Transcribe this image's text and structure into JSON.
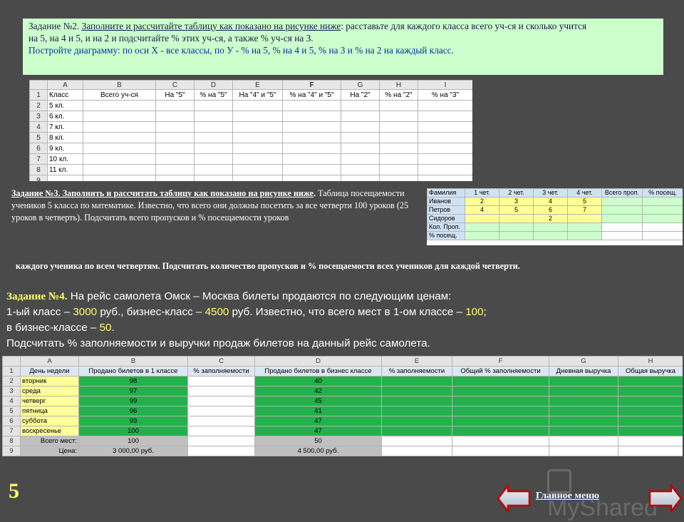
{
  "task2": {
    "line1_a": "Задание №2. ",
    "line1_u": "Заполните и рассчитайте таблицу как показано на рисунке ниже",
    "line1_b": ": расставьте  для каждого класса всего уч-ся и сколько учится",
    "line2": "на 5, на 4 и 5,  и на 2 и подсчитайте % этих уч-ся, а также % уч-ся на 3.",
    "line3": "Постройте диаграмму: по оси Х - все классы, по У - % на 5, % на 4 и 5, % на 3  и % на 2 на каждый класс."
  },
  "sheet1": {
    "cols": [
      "A",
      "B",
      "C",
      "D",
      "E",
      "F",
      "G",
      "H",
      "I"
    ],
    "rows": [
      "1",
      "2",
      "3",
      "4",
      "5",
      "6",
      "7",
      "8",
      "9"
    ],
    "headers": [
      "Класс",
      "Всего уч-ся",
      "На \"5\"",
      "% на \"5\"",
      "На \"4\" и \"5\"",
      "% на \"4\" и \"5\"",
      "На \"2\"",
      "% на \"2\"",
      "% на \"3\""
    ],
    "classes": [
      "5 кл.",
      "6 кл.",
      "7 кл.",
      "8 кл.",
      "9 кл.",
      "10 кл.",
      "11 кл."
    ]
  },
  "task3": {
    "title": "Задание №3. Заполнить и рассчитать таблицу как показано на рисунке ниже",
    "dot": ".",
    "body": "Таблица посещаемости учеников 5 класса по математике. Известно, что всего они должны посетить за все четверти 100 уроков (25 уроков в четверть). Подсчитать всего пропусков и % посещаемости уроков",
    "continuation": "каждого ученика по всем четвертям. Подсчитать количество пропусков и % посещаемости всех учеников для каждой четверти."
  },
  "sheet2": {
    "headers": [
      "Фамилия",
      "1 чет.",
      "2 чет.",
      "3 чет.",
      "4 чет.",
      "Всего проп.",
      "% посещ."
    ],
    "rows": [
      {
        "name": "Иванов",
        "q": [
          "2",
          "3",
          "4",
          "5"
        ]
      },
      {
        "name": "Петров",
        "q": [
          "4",
          "5",
          "6",
          "7"
        ]
      },
      {
        "name": "Сидоров",
        "q": [
          "",
          "",
          "2",
          ""
        ]
      }
    ],
    "footer": [
      "Кол. Проп.",
      "% посещ."
    ]
  },
  "task4": {
    "label": "Задание №4.",
    "line1": " На рейс самолета Омск – Москва билеты продаются по следующим ценам:",
    "l2a": "1-ый класс – ",
    "l2b": "3000",
    "l2c": " руб., бизнес-класс – ",
    "l2d": "4500",
    "l2e": " руб. Известно, что всего мест в 1-ом классе – ",
    "l2f": "100",
    "l2g": ";",
    "l3a": "в бизнес-классе – ",
    "l3b": "50",
    "l3c": ".",
    "line4": "Подсчитать % заполняемости и выручки продаж билетов на данный рейс самолета."
  },
  "sheet3": {
    "cols": [
      "A",
      "B",
      "C",
      "D",
      "E",
      "F",
      "G",
      "H"
    ],
    "rows": [
      "1",
      "2",
      "3",
      "4",
      "5",
      "6",
      "7",
      "8",
      "9"
    ],
    "headers": [
      "День недели",
      "Продано билетов в 1 классе",
      "% заполняемости",
      "Продано билетов в бизнес классе",
      "% заполняемости",
      "Общий % заполняемости",
      "Дневная выручка",
      "Общая выручка"
    ],
    "days": [
      {
        "day": "вторник",
        "first": "98",
        "biz": "40"
      },
      {
        "day": "среда",
        "first": "97",
        "biz": "42"
      },
      {
        "day": "четверг",
        "first": "99",
        "biz": "45"
      },
      {
        "day": "пятница",
        "first": "96",
        "biz": "41"
      },
      {
        "day": "суббота",
        "first": "99",
        "biz": "47"
      },
      {
        "day": "воскресенье",
        "first": "100",
        "biz": "47"
      }
    ],
    "total_label": "Всего мест:",
    "total_first": "100",
    "total_biz": "50",
    "price_label": "Цена:",
    "price_first": "3 000,00 руб.",
    "price_biz": "4 500,00 руб."
  },
  "footer": {
    "page_number": "5",
    "logo_text": "MyShared",
    "main_menu": "Главное меню"
  }
}
